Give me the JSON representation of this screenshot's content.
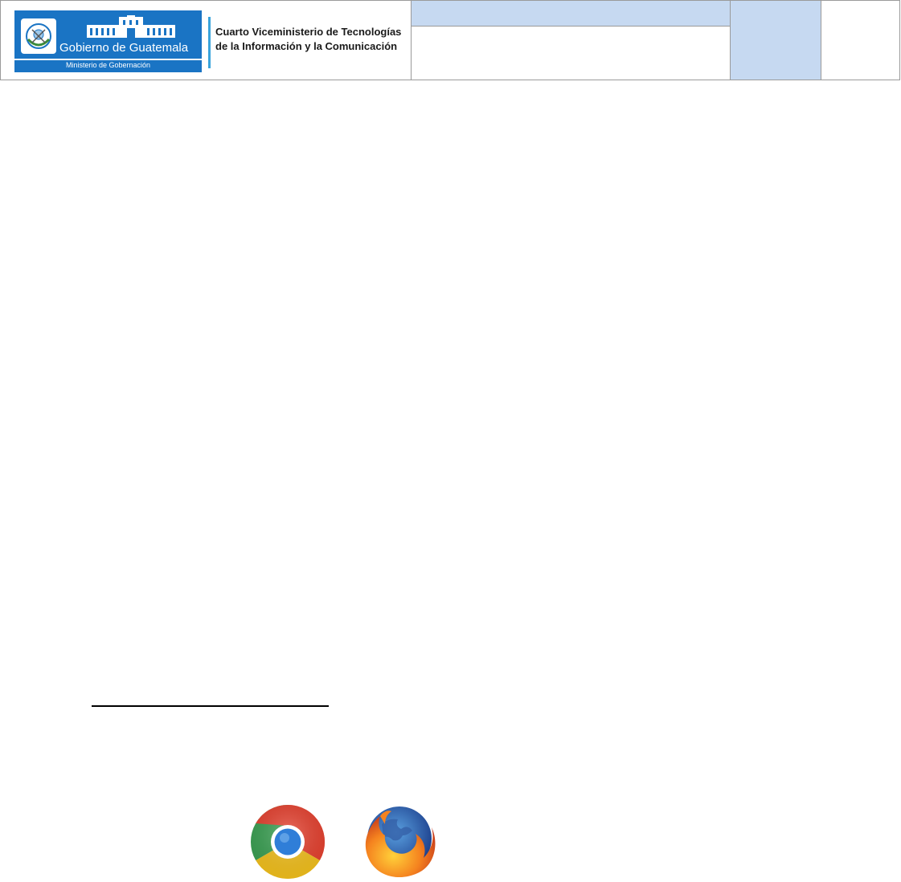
{
  "header": {
    "logo": {
      "name": "Gobierno de Guatemala",
      "ministry": "Ministerio de Gobernación"
    },
    "vice_ministry": {
      "line1": "Cuarto Viceministerio de Tecnologías",
      "line2": "de la Información y la Comunicación"
    }
  },
  "icons": {
    "chrome": "chrome-icon",
    "firefox": "firefox-icon"
  },
  "colors": {
    "header_fill": "#c6d9f1",
    "logo_blue": "#1a74c4",
    "accent_bar": "#3aa4dc"
  }
}
